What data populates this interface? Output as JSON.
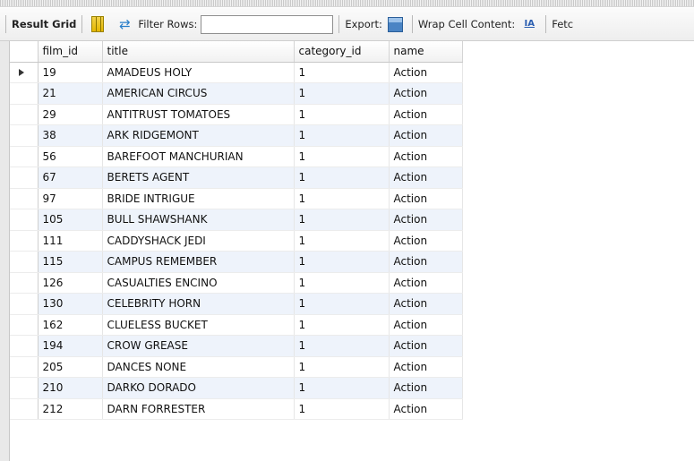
{
  "toolbar": {
    "result_grid_label": "Result Grid",
    "filter_rows_label": "Filter Rows:",
    "filter_value": "",
    "export_label": "Export:",
    "wrap_label": "Wrap Cell Content:",
    "wrap_icon_text": "IA",
    "fetch_label": "Fetc",
    "icons": [
      "result-grid-icon",
      "refresh-icon",
      "export-icon",
      "wrap-cell-icon"
    ]
  },
  "grid": {
    "columns": [
      "film_id",
      "title",
      "category_id",
      "name"
    ],
    "selected_row": 0,
    "rows": [
      [
        "19",
        "AMADEUS HOLY",
        "1",
        "Action"
      ],
      [
        "21",
        "AMERICAN CIRCUS",
        "1",
        "Action"
      ],
      [
        "29",
        "ANTITRUST TOMATOES",
        "1",
        "Action"
      ],
      [
        "38",
        "ARK RIDGEMONT",
        "1",
        "Action"
      ],
      [
        "56",
        "BAREFOOT MANCHURIAN",
        "1",
        "Action"
      ],
      [
        "67",
        "BERETS AGENT",
        "1",
        "Action"
      ],
      [
        "97",
        "BRIDE INTRIGUE",
        "1",
        "Action"
      ],
      [
        "105",
        "BULL SHAWSHANK",
        "1",
        "Action"
      ],
      [
        "111",
        "CADDYSHACK JEDI",
        "1",
        "Action"
      ],
      [
        "115",
        "CAMPUS REMEMBER",
        "1",
        "Action"
      ],
      [
        "126",
        "CASUALTIES ENCINO",
        "1",
        "Action"
      ],
      [
        "130",
        "CELEBRITY HORN",
        "1",
        "Action"
      ],
      [
        "162",
        "CLUELESS BUCKET",
        "1",
        "Action"
      ],
      [
        "194",
        "CROW GREASE",
        "1",
        "Action"
      ],
      [
        "205",
        "DANCES NONE",
        "1",
        "Action"
      ],
      [
        "210",
        "DARKO DORADO",
        "1",
        "Action"
      ],
      [
        "212",
        "DARN FORRESTER",
        "1",
        "Action"
      ]
    ]
  }
}
